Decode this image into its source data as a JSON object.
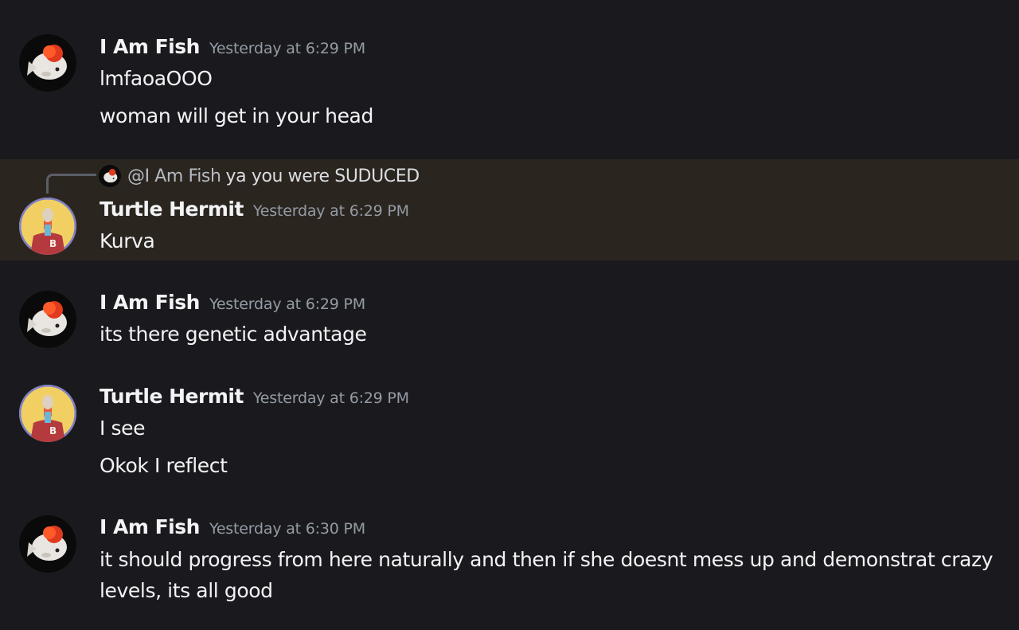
{
  "messages": [
    {
      "author": "I Am Fish",
      "timestamp": "Yesterday at 6:29 PM",
      "avatar": "goldfish-avatar",
      "lines": [
        "lmfaoaOOO",
        "woman will get in your head"
      ]
    },
    {
      "author": "Turtle Hermit",
      "timestamp": "Yesterday at 6:29 PM",
      "avatar": "turtle-hermit-avatar",
      "reply": {
        "mention": "@I Am Fish",
        "text": "ya you were SUDUCED"
      },
      "lines": [
        "Kurva"
      ]
    },
    {
      "author": "I Am Fish",
      "timestamp": "Yesterday at 6:29 PM",
      "avatar": "goldfish-avatar",
      "lines": [
        "its there genetic advantage"
      ]
    },
    {
      "author": "Turtle Hermit",
      "timestamp": "Yesterday at 6:29 PM",
      "avatar": "turtle-hermit-avatar",
      "lines": [
        "I see",
        "Okok I reflect"
      ]
    },
    {
      "author": "I Am Fish",
      "timestamp": "Yesterday at 6:30 PM",
      "avatar": "goldfish-avatar",
      "lines": [
        "it should progress from here naturally and then if she doesnt mess up and demonstrat crazy levels, its all good"
      ]
    }
  ],
  "colors": {
    "background": "#1a1a1e",
    "highlight": "#2b2520",
    "username": "#f2f3f5",
    "timestamp": "#949ba4",
    "text": "#f2f3f5"
  }
}
